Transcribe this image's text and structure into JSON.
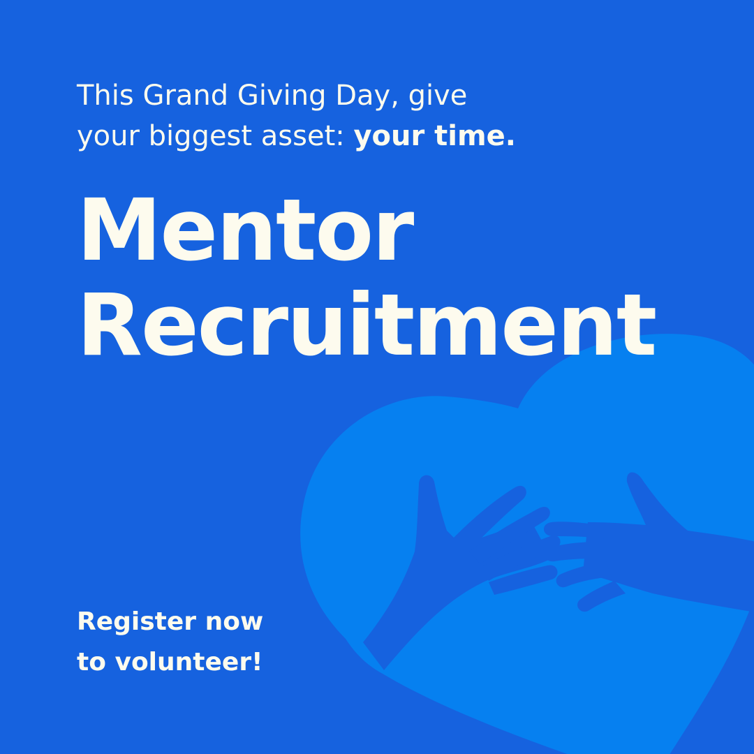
{
  "intro": {
    "line1": "This Grand Giving Day, give",
    "line2_regular": "your biggest asset: ",
    "line2_bold": "your time."
  },
  "headline": {
    "line1": "Mentor",
    "line2": "Recruitment"
  },
  "cta": {
    "line1": "Register now",
    "line2": "to volunteer!"
  },
  "colors": {
    "background": "#1662df",
    "heart": "#0680f0",
    "hands": "#1662df",
    "text": "#fdfbee"
  },
  "icons": [
    "heart-icon",
    "left-hand-icon",
    "right-hand-icon"
  ]
}
